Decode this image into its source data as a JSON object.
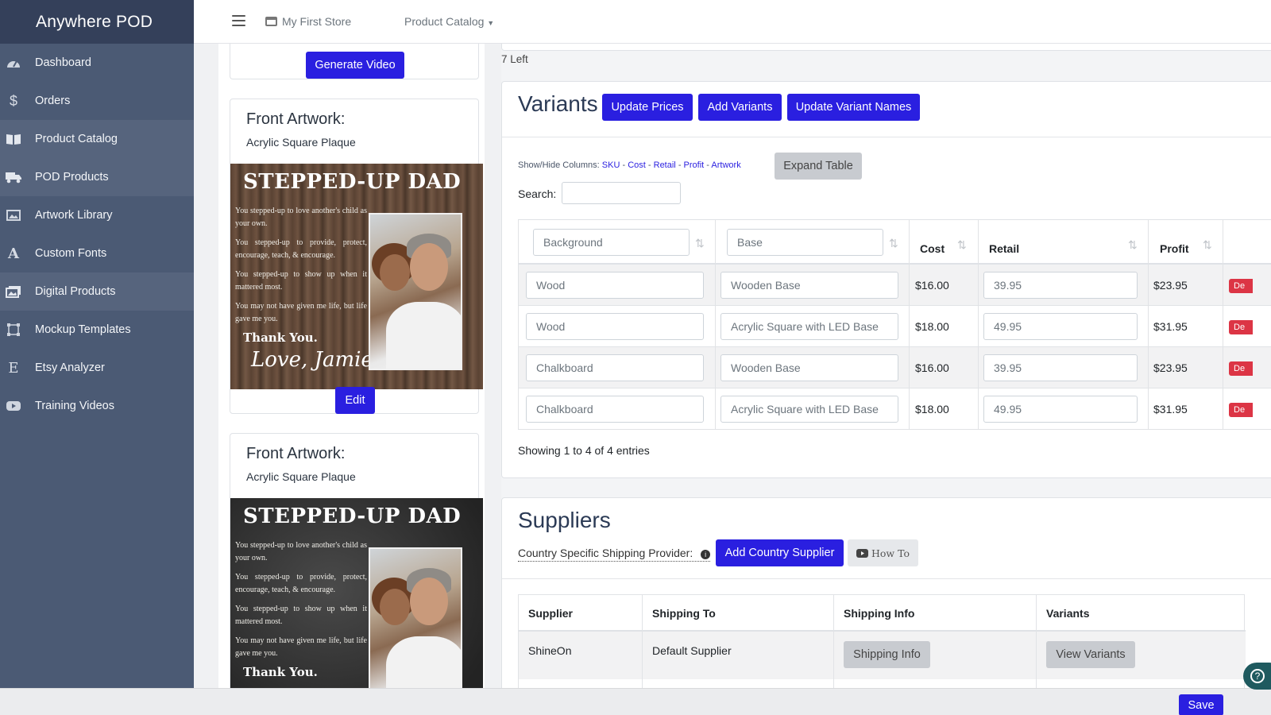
{
  "app": {
    "title": "Anywhere POD"
  },
  "sidebar": {
    "items": [
      {
        "label": "Dashboard",
        "icon": "dashboard-icon",
        "active": false
      },
      {
        "label": "Orders",
        "icon": "dollar-icon",
        "active": false
      },
      {
        "label": "Product Catalog",
        "icon": "book-icon",
        "active": true
      },
      {
        "label": "POD Products",
        "icon": "truck-icon",
        "active": true
      },
      {
        "label": "Artwork Library",
        "icon": "image-icon",
        "active": false
      },
      {
        "label": "Custom Fonts",
        "icon": "font-icon",
        "active": false
      },
      {
        "label": "Digital Products",
        "icon": "images-icon",
        "active": true
      },
      {
        "label": "Mockup Templates",
        "icon": "vector-icon",
        "active": false
      },
      {
        "label": "Etsy Analyzer",
        "icon": "etsy-icon",
        "active": false
      },
      {
        "label": "Training Videos",
        "icon": "youtube-icon",
        "active": false
      }
    ]
  },
  "topbar": {
    "store": "My First Store",
    "catalog": "Product Catalog"
  },
  "left": {
    "generate_video": "Generate Video",
    "artworks": [
      {
        "title": "Front Artwork:",
        "subtitle": "Acrylic Square Plaque",
        "plaque_title": "STEPPED-UP DAD",
        "lines": [
          "You stepped-up to love another's child as your own.",
          "You stepped-up to provide, protect, encourage, teach, & encourage.",
          "You stepped-up to show up when it mattered most.",
          "You may not have given me life, but life gave me you."
        ],
        "thanks": "Thank You.",
        "signature": "Love, Jamie",
        "edit": "Edit"
      },
      {
        "title": "Front Artwork:",
        "subtitle": "Acrylic Square Plaque",
        "plaque_title": "STEPPED-UP DAD",
        "lines": [
          "You stepped-up to love another's child as your own.",
          "You stepped-up to provide, protect, encourage, teach, & encourage.",
          "You stepped-up to show up when it mattered most.",
          "You may not have given me life, but life gave me you."
        ],
        "thanks": "Thank You."
      }
    ]
  },
  "right": {
    "left_count": "7 Left",
    "variants": {
      "title": "Variants",
      "buttons": [
        "Update Prices",
        "Add Variants",
        "Update Variant Names"
      ],
      "show_hide_label": "Show/Hide Columns:",
      "columns_links": [
        "SKU",
        "Cost",
        "Retail",
        "Profit",
        "Artwork"
      ],
      "separator": "-",
      "expand": "Expand Table",
      "search_label": "Search:",
      "headers": {
        "background": "Background",
        "base": "Base",
        "cost": "Cost",
        "retail": "Retail",
        "profit": "Profit"
      },
      "rows": [
        {
          "background": "Wood",
          "base": "Wooden Base",
          "cost": "$16.00",
          "retail": "39.95",
          "profit": "$23.95",
          "delete": "De"
        },
        {
          "background": "Wood",
          "base": "Acrylic Square with LED Base",
          "cost": "$18.00",
          "retail": "49.95",
          "profit": "$31.95",
          "delete": "De"
        },
        {
          "background": "Chalkboard",
          "base": "Wooden Base",
          "cost": "$16.00",
          "retail": "39.95",
          "profit": "$23.95",
          "delete": "De"
        },
        {
          "background": "Chalkboard",
          "base": "Acrylic Square with LED Base",
          "cost": "$18.00",
          "retail": "49.95",
          "profit": "$31.95",
          "delete": "De"
        }
      ],
      "showing": "Showing 1 to 4 of 4 entries"
    },
    "suppliers": {
      "title": "Suppliers",
      "country_label": "Country Specific Shipping Provider:",
      "add_country": "Add Country Supplier",
      "how_to": "How To",
      "headers": [
        "Supplier",
        "Shipping To",
        "Shipping Info",
        "Variants"
      ],
      "rows": [
        {
          "supplier": "ShineOn",
          "shipping_to": "Default Supplier",
          "shipping_info": "Shipping Info",
          "variants": "View Variants"
        }
      ]
    }
  },
  "footer": {
    "save": "Save",
    "help": "?"
  },
  "colors": {
    "sidebar": "#4b5a74",
    "brand": "#34405a",
    "primary": "#2a1fe0",
    "danger": "#dc3545"
  }
}
